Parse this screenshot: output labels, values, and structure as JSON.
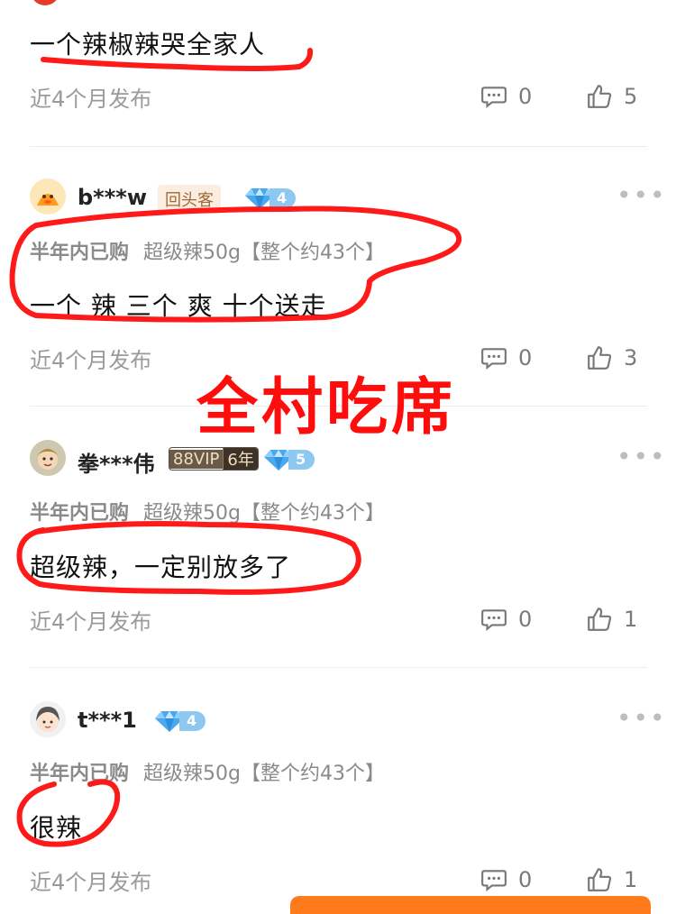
{
  "overlay_text": "全村吃席",
  "reviews": [
    {
      "text": "一个辣椒辣哭全家人",
      "time": "近4个月发布",
      "comments": "0",
      "likes": "5"
    },
    {
      "username": "b***w",
      "tag": "回头客",
      "diamond_level": "4",
      "purchase_badge": "半年内已购",
      "sku": "超级辣50g【整个约43个】",
      "text": "一个 辣 三个 爽 十个送走",
      "time": "近4个月发布",
      "comments": "0",
      "likes": "3"
    },
    {
      "username": "拳***伟",
      "vip_label": "88VIP",
      "vip_years": "6年",
      "diamond_level": "5",
      "purchase_badge": "半年内已购",
      "sku": "超级辣50g【整个约43个】",
      "text": "超级辣，一定别放多了",
      "time": "近4个月发布",
      "comments": "0",
      "likes": "1"
    },
    {
      "username": "t***1",
      "diamond_level": "4",
      "purchase_badge": "半年内已购",
      "sku": "超级辣50g【整个约43个】",
      "text": "很辣",
      "time": "近4个月发布",
      "comments": "0",
      "likes": "1"
    }
  ],
  "colors": {
    "annotation_red": "#ff1a1a",
    "diamond_blue": "#5bb4f0",
    "accent_orange": "#ff7a1a"
  }
}
